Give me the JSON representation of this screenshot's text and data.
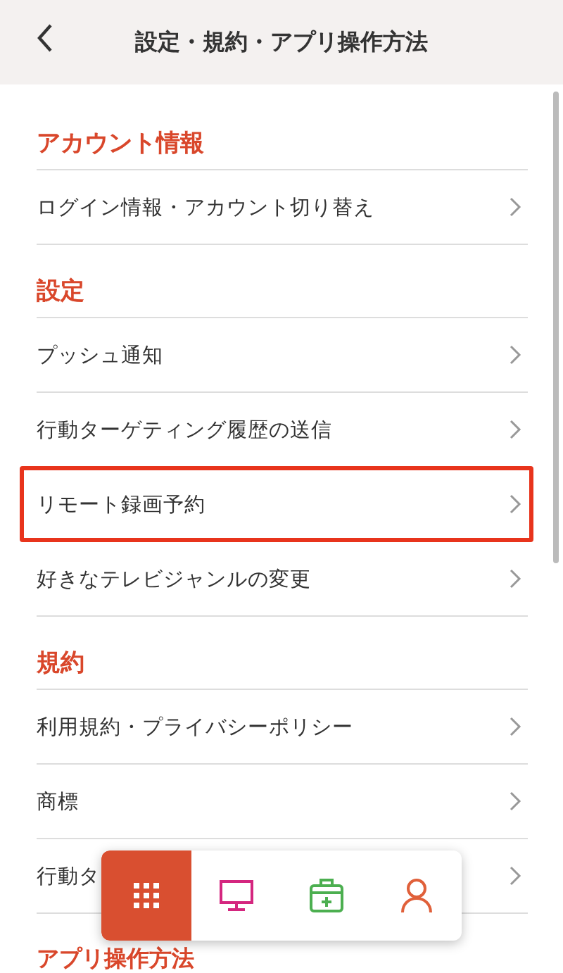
{
  "header": {
    "title": "設定・規約・アプリ操作方法"
  },
  "sections": [
    {
      "title": "アカウント情報",
      "items": [
        {
          "label": "ログイン情報・アカウント切り替え",
          "highlighted": false
        }
      ]
    },
    {
      "title": "設定",
      "items": [
        {
          "label": "プッシュ通知",
          "highlighted": false
        },
        {
          "label": "行動ターゲティング履歴の送信",
          "highlighted": false
        },
        {
          "label": "リモート録画予約",
          "highlighted": true
        },
        {
          "label": "好きなテレビジャンルの変更",
          "highlighted": false
        }
      ]
    },
    {
      "title": "規約",
      "items": [
        {
          "label": "利用規約・プライバシーポリシー",
          "highlighted": false
        },
        {
          "label": "商標",
          "highlighted": false
        },
        {
          "label": "行動タ",
          "highlighted": false
        }
      ]
    },
    {
      "title": "アプリ操作方法"
    }
  ],
  "nav": [
    {
      "kind": "grid",
      "selected": true,
      "color": "#ffffff"
    },
    {
      "kind": "tv",
      "selected": false,
      "color": "#d4267f"
    },
    {
      "kind": "kit",
      "selected": false,
      "color": "#4caf50"
    },
    {
      "kind": "person",
      "selected": false,
      "color": "#e0603a"
    }
  ]
}
